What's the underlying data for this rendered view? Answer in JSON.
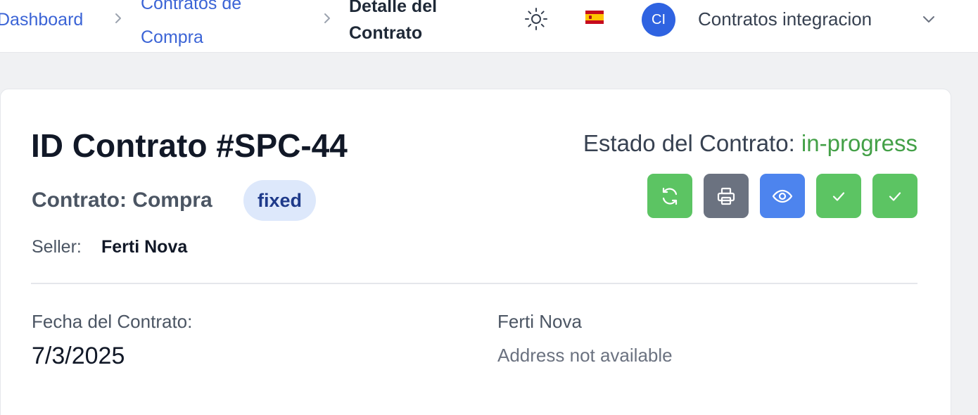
{
  "breadcrumb": {
    "dashboard": "Dashboard",
    "contracts_line1": "Contratos de",
    "contracts_line2": "Compra",
    "current_line1": "Detalle del",
    "current_line2": "Contrato"
  },
  "header": {
    "theme_icon": "sun-icon",
    "language_icon": "spain-flag-icon",
    "avatar_initials": "CI",
    "user_name": "Contratos integracion",
    "menu_icon": "chevron-down-icon"
  },
  "contract": {
    "title": "ID Contrato #SPC-44",
    "type_text": "Contrato: Compra",
    "pricing_badge": "fixed",
    "seller_label": "Seller:",
    "seller_name": "Ferti Nova",
    "status_label": "Estado del Contrato: ",
    "status_value": "in-progress",
    "date_label": "Fecha del Contrato:",
    "date_value": "7/3/2025",
    "party_name": "Ferti Nova",
    "party_address": "Address not available"
  },
  "actions": [
    {
      "icon": "refresh-icon",
      "color": "#5cc463"
    },
    {
      "icon": "printer-icon",
      "color": "#6b7280"
    },
    {
      "icon": "eye-icon",
      "color": "#4d84ee"
    },
    {
      "icon": "check-icon",
      "color": "#5cc463"
    },
    {
      "icon": "check-icon",
      "color": "#5cc463"
    }
  ],
  "colors": {
    "link": "#3b64d6",
    "status_green": "#43a047",
    "avatar": "#2f63e1",
    "badge_bg": "#dde8fb",
    "badge_text": "#1e3a8a"
  }
}
